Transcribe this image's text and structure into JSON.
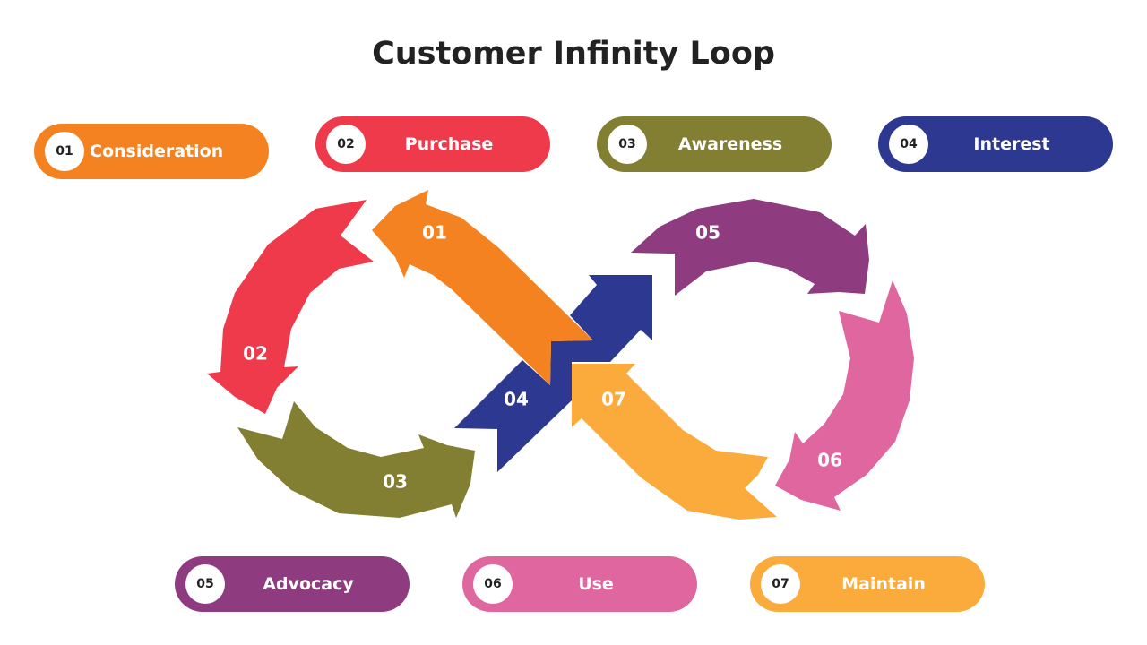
{
  "title": "Customer Infinity Loop",
  "colors": {
    "c01": "#F58220",
    "c02": "#EF3A4B",
    "c03": "#827F33",
    "c04": "#2D3991",
    "c05": "#8E3B80",
    "c06": "#E066A0",
    "c07": "#FBAA3C"
  },
  "pills": [
    {
      "num": "01",
      "label": "Consideration"
    },
    {
      "num": "02",
      "label": "Purchase"
    },
    {
      "num": "03",
      "label": "Awareness"
    },
    {
      "num": "04",
      "label": "Interest"
    },
    {
      "num": "05",
      "label": "Advocacy"
    },
    {
      "num": "06",
      "label": "Use"
    },
    {
      "num": "07",
      "label": "Maintain"
    }
  ],
  "segments": [
    "01",
    "02",
    "03",
    "04",
    "05",
    "06",
    "07"
  ]
}
